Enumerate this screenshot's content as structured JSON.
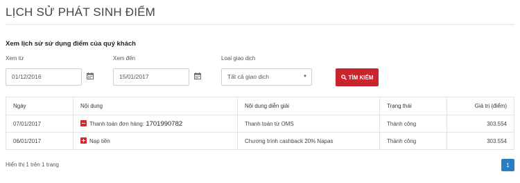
{
  "page": {
    "title": "LỊCH SỬ PHÁT SINH ĐIỂM",
    "subtitle": "Xem lịch sử sử dụng điểm của quý khách"
  },
  "filters": {
    "from_label": "Xem từ",
    "from_value": "01/12/2016",
    "to_label": "Xem đến",
    "to_value": "15/01/2017",
    "type_label": "Loại giao dịch",
    "type_value": "Tất cả giao dịch",
    "search_label": "TÌM KIẾM",
    "calendar_icon": "calendar-icon",
    "search_icon": "search-icon"
  },
  "table": {
    "headers": [
      "Ngày",
      "Nội dung",
      "Nội dung diễn giải",
      "Trạng thái",
      "Giá trị (điểm)"
    ],
    "rows": [
      {
        "date": "07/01/2017",
        "icon": "minus-square-icon",
        "content_prefix": "Thanh toán đơn hàng:",
        "content_number": "1701990782",
        "description": "Thanh toán từ OMS",
        "status": "Thành công",
        "value": "303.554"
      },
      {
        "date": "06/01/2017",
        "icon": "plus-square-icon",
        "content_prefix": "Nạp tiền",
        "content_number": "",
        "description": "Chương trình cashback 20% Napas",
        "status": "Thành công",
        "value": "303.554"
      }
    ]
  },
  "pagination": {
    "summary": "Hiển thị 1 trên 1 trang",
    "current_page": "1"
  },
  "colors": {
    "accent_red": "#c9252c",
    "page_blue": "#2a7fc4"
  }
}
